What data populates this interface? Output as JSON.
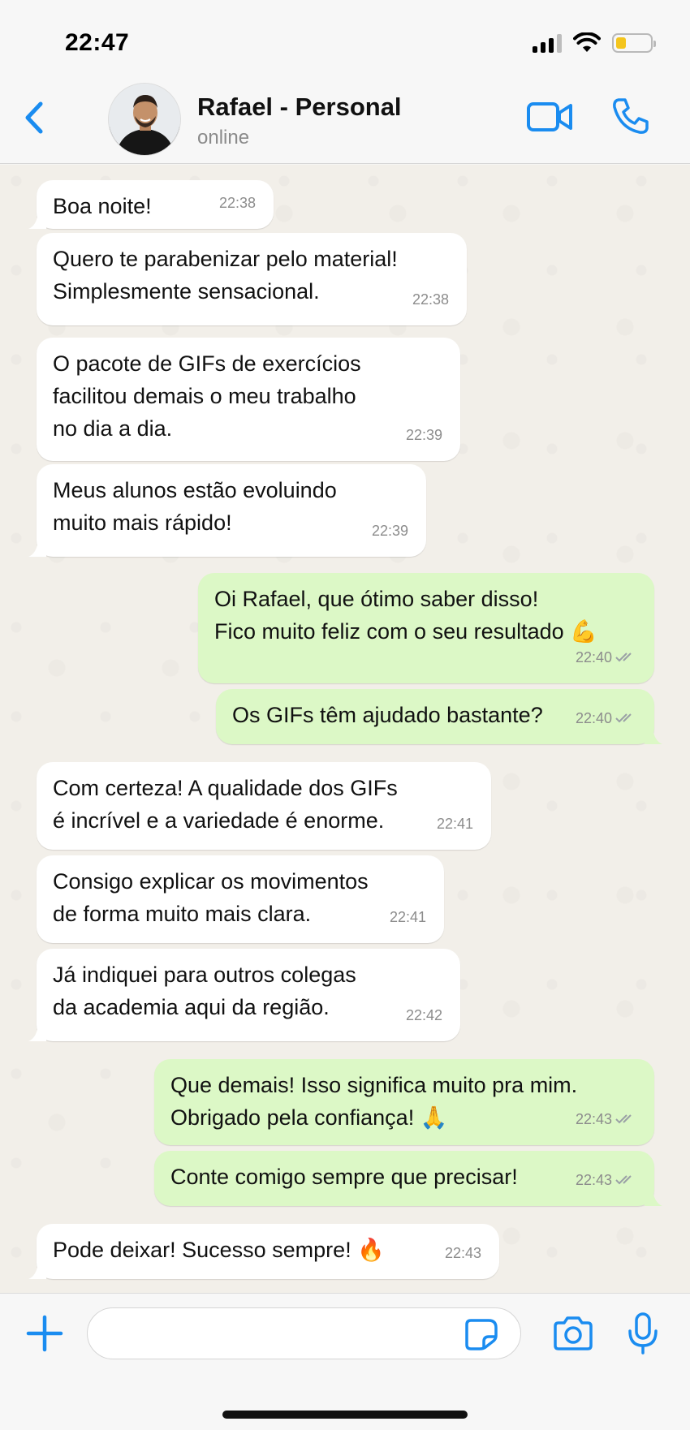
{
  "status_bar": {
    "time": "22:47"
  },
  "header": {
    "contact_name": "Rafael - Personal",
    "contact_status": "online"
  },
  "messages": [
    {
      "direction": "in",
      "text": "Boa noite!",
      "time": "22:38"
    },
    {
      "direction": "in",
      "text": "Quero te parabenizar pelo material!\nSimplesmente sensacional.",
      "time": "22:38"
    },
    {
      "direction": "in",
      "text": "O pacote de GIFs de exercícios\nfacilitou demais o meu trabalho\nno dia a dia.",
      "time": "22:39"
    },
    {
      "direction": "in",
      "text": "Meus alunos estão evoluindo\nmuito mais rápido!",
      "time": "22:39"
    },
    {
      "direction": "out",
      "text": "Oi Rafael, que ótimo saber disso!\nFico muito feliz com o seu resultado 💪",
      "time": "22:40"
    },
    {
      "direction": "out",
      "text": "Os GIFs têm ajudado bastante?",
      "time": "22:40"
    },
    {
      "direction": "in",
      "text": "Com certeza! A qualidade dos GIFs\né incrível e a variedade é enorme.",
      "time": "22:41"
    },
    {
      "direction": "in",
      "text": "Consigo explicar os movimentos\nde forma muito mais clara.",
      "time": "22:41"
    },
    {
      "direction": "in",
      "text": "Já indiquei para outros colegas\nda academia aqui da região.",
      "time": "22:42"
    },
    {
      "direction": "out",
      "text": "Que demais! Isso significa muito pra mim.\nObrigado pela confiança! 🙏",
      "time": "22:43"
    },
    {
      "direction": "out",
      "text": "Conte comigo sempre que precisar!",
      "time": "22:43"
    },
    {
      "direction": "in",
      "text": "Pode deixar! Sucesso sempre! 🔥",
      "time": "22:43"
    }
  ],
  "composer": {
    "value": ""
  },
  "colors": {
    "accent": "#1a8cf0",
    "incoming_bubble": "#ffffff",
    "outgoing_bubble": "#dcf8c6",
    "chat_background": "#f2efe9"
  },
  "icons": {
    "back": "chevron-left-icon",
    "video": "video-camera-icon",
    "phone": "phone-icon",
    "attach": "plus-icon",
    "sticker": "sticker-icon",
    "camera": "camera-icon",
    "mic": "microphone-icon",
    "read_receipt": "double-check-icon"
  }
}
